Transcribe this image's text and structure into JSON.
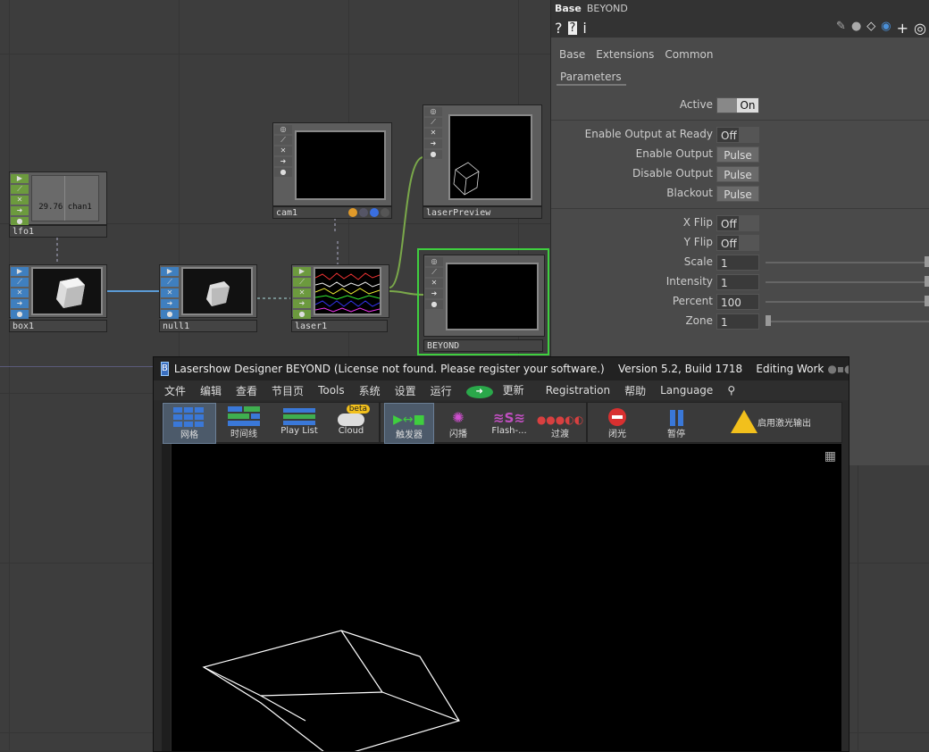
{
  "nodes": {
    "lfo1": {
      "label": "lfo1",
      "readout": "29.76 chan1"
    },
    "box1": {
      "label": "box1"
    },
    "null1": {
      "label": "null1"
    },
    "cam1": {
      "label": "cam1"
    },
    "laser1": {
      "label": "laser1"
    },
    "laserPreview": {
      "label": "laserPreview"
    },
    "beyond": {
      "label": "BEYOND"
    }
  },
  "panel": {
    "type": "Base",
    "name": "BEYOND",
    "tabs": [
      "Base",
      "Extensions",
      "Common"
    ],
    "subtab": "Parameters",
    "params": [
      {
        "label": "Active",
        "value": "On"
      },
      {
        "label": "Enable Output at Ready",
        "value": "Off"
      },
      {
        "label": "Enable Output",
        "value": "Pulse"
      },
      {
        "label": "Disable Output",
        "value": "Pulse"
      },
      {
        "label": "Blackout",
        "value": "Pulse"
      },
      {
        "label": "X Flip",
        "value": "Off"
      },
      {
        "label": "Y Flip",
        "value": "Off"
      },
      {
        "label": "Scale",
        "value": "1"
      },
      {
        "label": "Intensity",
        "value": "1"
      },
      {
        "label": "Percent",
        "value": "100"
      },
      {
        "label": "Zone",
        "value": "1"
      }
    ]
  },
  "beyond_window": {
    "title": "Lasershow Designer BEYOND (License not found. Please register your software.)    Version 5.2, Build 1718    Editing Work",
    "title_tail": "B",
    "menu": [
      "文件",
      "编辑",
      "查看",
      "节目页",
      "Tools",
      "系统",
      "设置",
      "运行",
      "更新",
      "Registration",
      "帮助",
      "Language"
    ],
    "toolbar": [
      {
        "label": "网格"
      },
      {
        "label": "时间线"
      },
      {
        "label": "Play List"
      },
      {
        "label": "Cloud",
        "badge": "beta"
      },
      {
        "label": "触发器"
      },
      {
        "label": "闪播"
      },
      {
        "label": "Flash-..."
      },
      {
        "label": "过渡"
      },
      {
        "label": "闭光"
      },
      {
        "label": "暂停"
      },
      {
        "label": "启用激光输出"
      }
    ]
  }
}
